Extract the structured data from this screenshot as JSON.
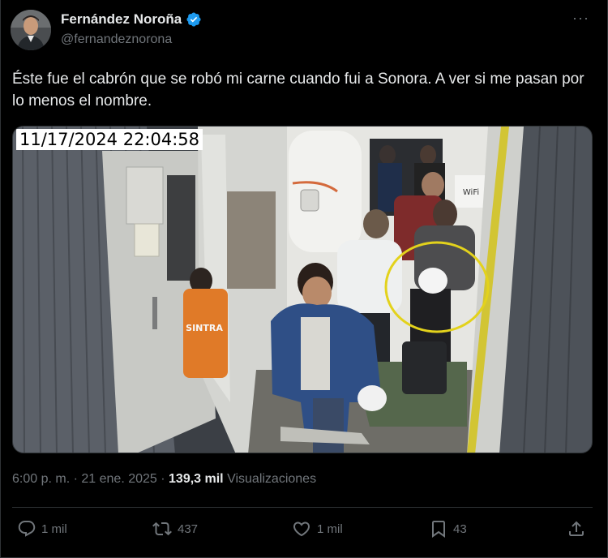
{
  "author": {
    "display_name": "Fernández Noroña",
    "handle": "@fernandeznorona"
  },
  "icons": {
    "verified": "verified-badge-icon",
    "more": "more-options-icon",
    "reply": "reply-icon",
    "repost": "repost-icon",
    "like": "like-icon",
    "bookmark": "bookmark-icon",
    "share": "share-icon"
  },
  "more_label": "···",
  "tweet": {
    "text": "Éste fue el cabrón que se robó mi carne cuando fui a Sonora. A ver si me pasan por lo menos el nombre."
  },
  "media": {
    "timestamp": "11/17/2024 22:04:58",
    "vest_text": "SINTRA",
    "wifi_label": "WiFi"
  },
  "meta": {
    "time": "6:00 p. m.",
    "separator": " · ",
    "date": "21 ene. 2025",
    "views_count": "139,3 mil",
    "views_label": "Visualizaciones"
  },
  "actions": {
    "replies": "1 mil",
    "reposts": "437",
    "likes": "1 mil",
    "bookmarks": "43"
  },
  "colors": {
    "background": "#000000",
    "text": "#e7e9ea",
    "secondary_text": "#71767b",
    "verified_blue": "#1d9bf0",
    "divider": "#2f3336",
    "highlight_circle": "#e3d21c"
  }
}
